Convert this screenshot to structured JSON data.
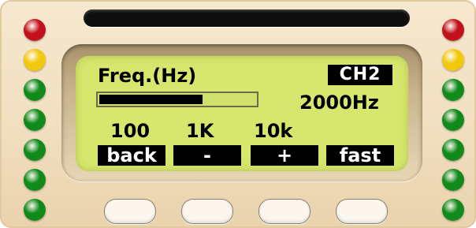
{
  "lcd": {
    "title": "Freq.(Hz)",
    "channel": "CH2",
    "frequency_readout": "2000Hz",
    "progress_fraction": 0.66,
    "scale_ticks": [
      "100",
      "1K",
      "10k"
    ],
    "softkeys": [
      "back",
      "-",
      "+",
      "fast"
    ]
  },
  "indicators": {
    "left": [
      "red",
      "yellow",
      "green",
      "green",
      "green",
      "green",
      "green"
    ],
    "right": [
      "red",
      "yellow",
      "green",
      "green",
      "green",
      "green",
      "green"
    ]
  },
  "colors": {
    "red": "#c1121c",
    "yellow": "#f2c80c",
    "green": "#108a1a",
    "lcd_background": "#d7e76e",
    "panel": "#f1dfc0"
  },
  "hardware_buttons": 4
}
